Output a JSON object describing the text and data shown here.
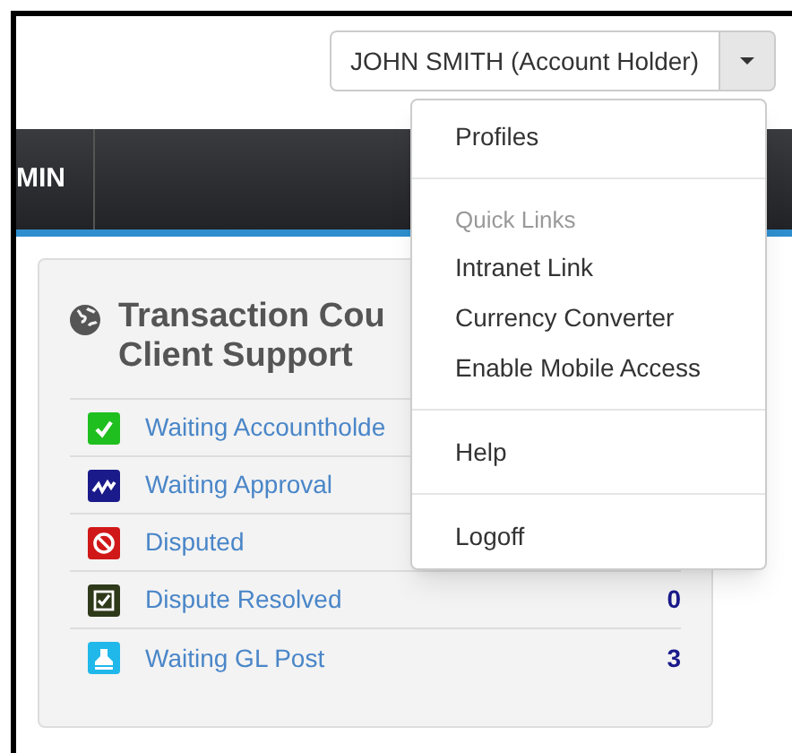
{
  "header": {
    "user_button": "JOHN SMITH (Account Holder)"
  },
  "nav": {
    "tab": "MIN"
  },
  "panel": {
    "title_lines": [
      "Transaction Cou",
      "Client Support"
    ],
    "rows": [
      {
        "kind": "check",
        "label": "Waiting Accountholde"
      },
      {
        "kind": "chart",
        "label": "Waiting Approval"
      },
      {
        "kind": "blocked",
        "label": "Disputed"
      },
      {
        "kind": "resolved",
        "label": "Dispute Resolved",
        "count": "0"
      },
      {
        "kind": "stamp",
        "label": "Waiting GL Post",
        "count": "3"
      }
    ]
  },
  "menu": {
    "items": [
      {
        "kind": "item",
        "label": "Profiles"
      },
      {
        "kind": "divider"
      },
      {
        "kind": "header",
        "label": "Quick Links"
      },
      {
        "kind": "item",
        "label": "Intranet Link"
      },
      {
        "kind": "item",
        "label": "Currency Converter"
      },
      {
        "kind": "item",
        "label": "Enable Mobile Access"
      },
      {
        "kind": "divider"
      },
      {
        "kind": "item",
        "label": "Help"
      },
      {
        "kind": "divider"
      },
      {
        "kind": "item",
        "label": "Logoff"
      }
    ]
  }
}
